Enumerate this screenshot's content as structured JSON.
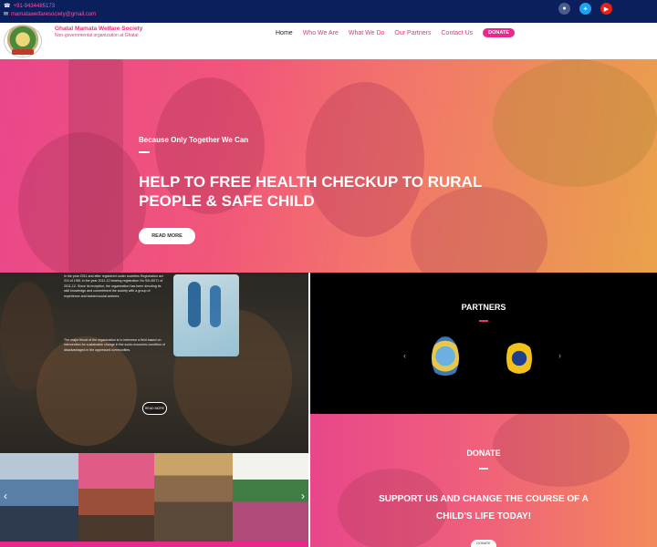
{
  "topbar": {
    "phone": "+91-9434485173",
    "email": "mamatawelfaresociety@gmail.com",
    "social": [
      "globe-icon",
      "twitter-icon",
      "youtube-icon"
    ]
  },
  "header": {
    "org_name": "Ghatal Mamata Welfare Society",
    "org_sub": "Non-governmental organization at Ghatal"
  },
  "nav": {
    "items": [
      "Home",
      "Who We Are",
      "What We Do",
      "Our Partners",
      "Contact Us"
    ],
    "donate": "DONATE"
  },
  "hero": {
    "tagline": "Because Only Together We Can",
    "title": "HELP TO FREE HEALTH CHECKUP TO RURAL PEOPLE & SAFE CHILD",
    "button": "READ MORE"
  },
  "about": {
    "paragraph1": "in the year 2011 and after registered under societies Registration act XXI of 1961 in the year 2011-12 bearing registration No S/IL/5071 of 2011-12. Since its inception, the organization has been devoting its skill knowledge and commitment the society with a group of experience and trained social workers.",
    "paragraph2": "The major thrust of the organization is to intervene a field based on intervention for sustainable change in the socio-economic condition of disadvantaged in the oppressed communities.",
    "button": "READ MORE"
  },
  "partners": {
    "title": "PARTNERS"
  },
  "donate": {
    "title": "DONATE",
    "line1": "SUPPORT US AND CHANGE THE COURSE OF A",
    "line2": "CHILD'S LIFE TODAY!",
    "button": "DONATE"
  },
  "colors": {
    "accent": "#e8288a",
    "topbar": "#0b1f5c"
  }
}
